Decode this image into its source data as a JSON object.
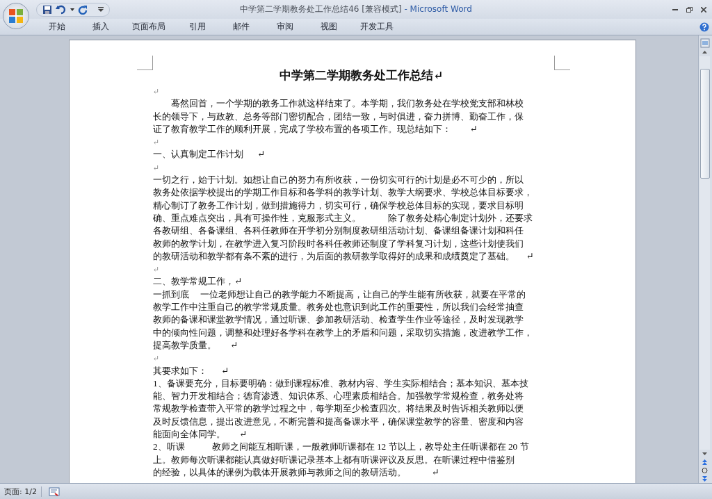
{
  "window": {
    "title": "中学第二学期教务处工作总结46 [兼容模式]",
    "separator": " - ",
    "app_name": "Microsoft Word"
  },
  "tabs": [
    {
      "label": "开始"
    },
    {
      "label": "插入"
    },
    {
      "label": "页面布局"
    },
    {
      "label": "引用"
    },
    {
      "label": "邮件"
    },
    {
      "label": "审阅"
    },
    {
      "label": "视图"
    },
    {
      "label": "开发工具"
    }
  ],
  "document": {
    "paragraphs": [
      {
        "kind": "title",
        "lines": [
          "中学第二学期教务处工作总结↵"
        ]
      },
      {
        "kind": "empty",
        "lines": [
          "↵"
        ]
      },
      {
        "kind": "body",
        "lines": [
          "　　蓦然回首，一个学期的教务工作就这样结束了。本学期，我们教务处在学校党支部和林校",
          "长的领导下，与政教、总务等部门密切配合，团结一致，与时俱进，奋力拼博、勤奋工作，保",
          "证了教育教学工作的顺利开展，完成了学校布置的各项工作。现总结如下：        ↵"
        ]
      },
      {
        "kind": "empty",
        "lines": [
          "↵"
        ]
      },
      {
        "kind": "heading",
        "lines": [
          "一、认真制定工作计划      ↵"
        ]
      },
      {
        "kind": "empty",
        "lines": [
          "↵"
        ]
      },
      {
        "kind": "body",
        "lines": [
          "一切之行，始于计划。如想让自己的努力有所收获，一份切实可行的计划是必不可少的，所以",
          "教务处依据学校提出的学期工作目标和各学科的教学计划、教学大纲要求、学校总体目标要求，",
          "精心制订了教务工作计划，做到措施得力，切实可行，确保学校总体目标的实现，要求目标明",
          "确、重点难点突出，具有可操作性，克服形式主义。　　　除了教务处精心制定计划外，还要求",
          "各教研组、各备课组、各科任教师在开学初分别制度教研组活动计划、备课组备课计划和科任",
          "教师的教学计划，在教学进入复习阶段时各科任教师还制度了学科复习计划，这些计划使我们",
          "的教研活动和教学都有条不紊的进行，为后面的教研教学取得好的成果和成绩奠定了基础。     ↵"
        ]
      },
      {
        "kind": "empty",
        "lines": [
          "↵"
        ]
      },
      {
        "kind": "heading",
        "lines": [
          "二、教学常规工作，↵"
        ]
      },
      {
        "kind": "body",
        "lines": [
          "一抓到底　 一位老师想让自己的教学能力不断提高，让自己的学生能有所收获，就要在平常的",
          "教学工作中注重自己的教学常规质量。教务处也意识到此工作的重要性，所以我们会经常抽查",
          "教师的备课和课堂教学情况，通过听课、参加教研活动、检查学生作业等途径，及时发现教学",
          "中的倾向性问题，调整和处理好各学科在教学上的矛盾和问题，采取切实措施，改进教学工作，",
          "提高教学质量。      ↵"
        ]
      },
      {
        "kind": "empty",
        "lines": [
          "↵"
        ]
      },
      {
        "kind": "heading",
        "lines": [
          "其要求如下：      ↵"
        ]
      },
      {
        "kind": "body",
        "lines": [
          "1、备课要充分，目标要明确：做到课程标准、教材内容、学生实际相结合；基本知识、基本技",
          "能、智力开发相结合；德育渗透、知识体系、心理素质相结合。加强教学常规检查，教务处将",
          "常规教学检查带入平常的教学过程之中，每学期至少检查四次。将结果及时告诉相关教师以便",
          "及时反馈信息，提出改进意见，不断完善和提高备课水平，确保课堂教学的容量、密度和内容",
          "能面向全体同学。      ↵"
        ]
      },
      {
        "kind": "body",
        "lines": [
          "2、听课　　　教师之间能互相听课，一般教师听课都在 12 节以上，教导处主任听课都在 20 节",
          "上。教师每次听课都能认真做好听课记录基本上都有听课评议及反思。在听课过程中借鉴别",
          "的经验，以具体的课例为载体开展教师与教师之间的教研活动。           ↵"
        ]
      }
    ]
  },
  "status_bar": {
    "page": "页面: 1/2"
  }
}
